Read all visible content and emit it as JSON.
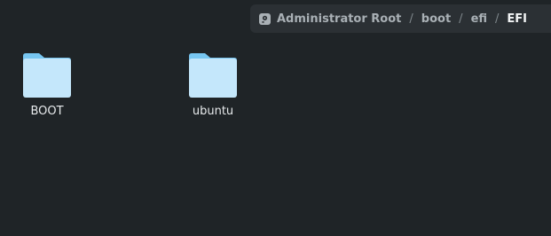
{
  "breadcrumb": {
    "root_icon": "drive-icon",
    "items": [
      {
        "label": "Administrator Root"
      },
      {
        "label": "boot"
      },
      {
        "label": "efi"
      },
      {
        "label": "EFI"
      }
    ],
    "separator": "/"
  },
  "files": [
    {
      "name": "BOOT",
      "icon": "folder-icon"
    },
    {
      "name": "ubuntu",
      "icon": "folder-icon"
    }
  ],
  "colors": {
    "background": "#1f2427",
    "pathbar": "#2b3034",
    "folder_body": "#c4e7fb",
    "folder_tab": "#77c6f1"
  }
}
